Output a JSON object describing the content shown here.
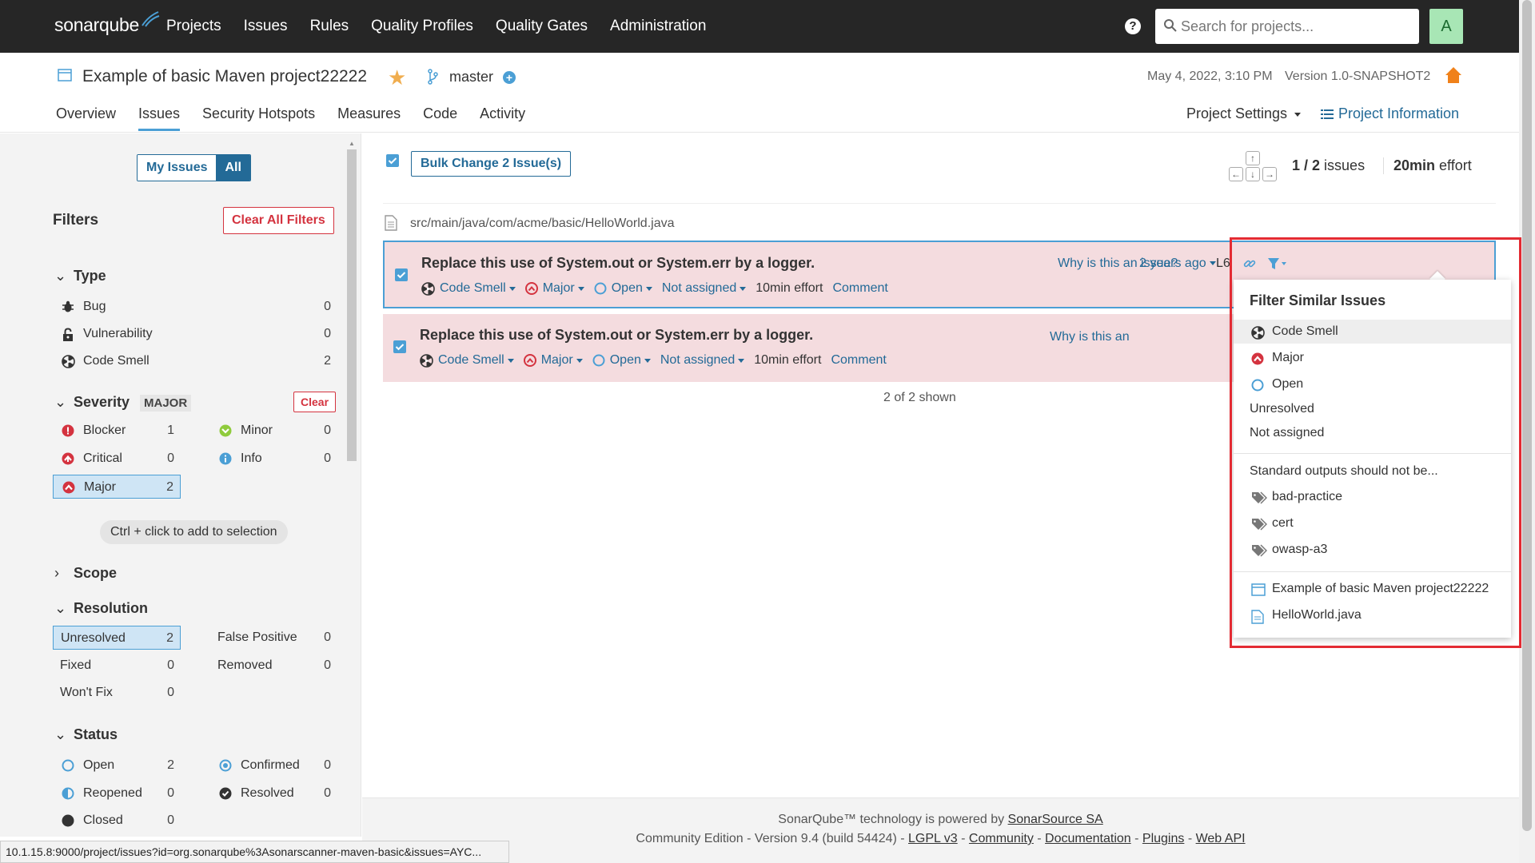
{
  "nav": {
    "logo": "sonarqube",
    "links": [
      "Projects",
      "Issues",
      "Rules",
      "Quality Profiles",
      "Quality Gates",
      "Administration"
    ],
    "search_placeholder": "Search for projects...",
    "avatar": "A"
  },
  "project": {
    "name": "Example of basic Maven project22222",
    "branch": "master",
    "date": "May 4, 2022, 3:10 PM",
    "version": "Version 1.0-SNAPSHOT2",
    "tabs": [
      "Overview",
      "Issues",
      "Security Hotspots",
      "Measures",
      "Code",
      "Activity"
    ],
    "active_tab": "Issues",
    "settings": "Project Settings",
    "info": "Project Information"
  },
  "sidebar": {
    "my_issues": "My Issues",
    "all": "All",
    "filters_title": "Filters",
    "clear_all": "Clear All Filters",
    "type": {
      "title": "Type",
      "items": [
        {
          "label": "Bug",
          "count": "0"
        },
        {
          "label": "Vulnerability",
          "count": "0"
        },
        {
          "label": "Code Smell",
          "count": "2"
        }
      ]
    },
    "severity": {
      "title": "Severity",
      "badge": "MAJOR",
      "clear": "Clear",
      "items": [
        {
          "label": "Blocker",
          "count": "1"
        },
        {
          "label": "Minor",
          "count": "0"
        },
        {
          "label": "Critical",
          "count": "0"
        },
        {
          "label": "Info",
          "count": "0"
        },
        {
          "label": "Major",
          "count": "2"
        }
      ]
    },
    "hint": "Ctrl + click to add to selection",
    "scope": {
      "title": "Scope"
    },
    "resolution": {
      "title": "Resolution",
      "items": [
        {
          "label": "Unresolved",
          "count": "2"
        },
        {
          "label": "False Positive",
          "count": "0"
        },
        {
          "label": "Fixed",
          "count": "0"
        },
        {
          "label": "Removed",
          "count": "0"
        },
        {
          "label": "Won't Fix",
          "count": "0"
        }
      ]
    },
    "status": {
      "title": "Status",
      "items": [
        {
          "label": "Open",
          "count": "2"
        },
        {
          "label": "Confirmed",
          "count": "0"
        },
        {
          "label": "Reopened",
          "count": "0"
        },
        {
          "label": "Resolved",
          "count": "0"
        },
        {
          "label": "Closed",
          "count": "0"
        }
      ]
    }
  },
  "main": {
    "bulk_change": "Bulk Change 2 Issue(s)",
    "count_current": "1",
    "count_total": "/ 2",
    "count_suffix": " issues",
    "effort_value": "20min",
    "effort_suffix": " effort",
    "file_path": "src/main/java/com/acme/basic/HelloWorld.java",
    "issues": [
      {
        "message": "Replace this use of System.out or System.err by a logger.",
        "type": "Code Smell",
        "severity": "Major",
        "status": "Open",
        "assignee": "Not assigned",
        "effort": "10min effort",
        "comment": "Comment",
        "why": "Why is this an issue?",
        "ago": "2 years ago",
        "line": "L6"
      },
      {
        "message": "Replace this use of System.out or System.err by a logger.",
        "type": "Code Smell",
        "severity": "Major",
        "status": "Open",
        "assignee": "Not assigned",
        "effort": "10min effort",
        "comment": "Comment",
        "why": "Why is this an"
      }
    ],
    "shown": "2 of 2 shown"
  },
  "dropdown": {
    "title": "Filter Similar Issues",
    "items": [
      "Code Smell",
      "Major",
      "Open",
      "Unresolved",
      "Not assigned",
      "Standard outputs should not be...",
      "bad-practice",
      "cert",
      "owasp-a3",
      "Example of basic Maven project22222",
      "HelloWorld.java"
    ]
  },
  "footer": {
    "line1_prefix": "SonarQube™ technology is powered by ",
    "line1_link": "SonarSource SA",
    "edition": "Community Edition - Version 9.4 (build 54424) - ",
    "lgpl": "LGPL v3",
    "community": "Community",
    "docs": "Documentation",
    "plugins": "Plugins",
    "webapi": "Web API"
  },
  "statusbar": "10.1.15.8:9000/project/issues?id=org.sonarqube%3Asonarscanner-maven-basic&issues=AYC...",
  "colors": {
    "accent": "#236a97",
    "issue_bg": "#f4dcdf",
    "highlight_box": "#e32b33",
    "topbar": "#262626"
  }
}
